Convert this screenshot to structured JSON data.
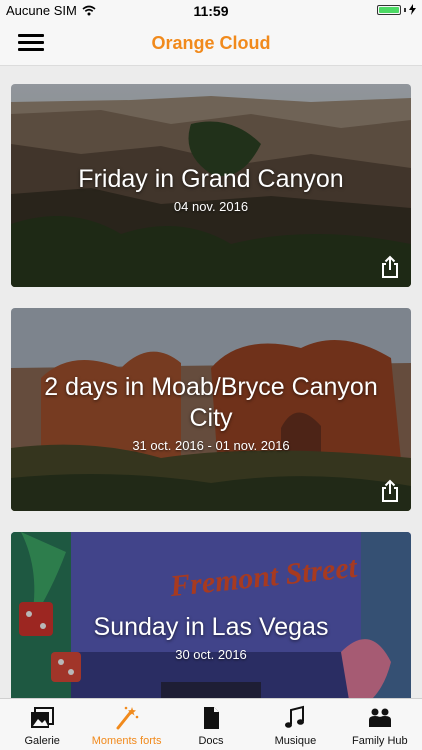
{
  "status_bar": {
    "carrier": "Aucune SIM",
    "time": "11:59",
    "battery_level": 1.0
  },
  "nav": {
    "title": "Orange Cloud",
    "accent_color": "#f18a1c"
  },
  "cards": [
    {
      "title": "Friday in Grand Canyon",
      "date": "04 nov. 2016"
    },
    {
      "title": "2 days in Moab/Bryce Canyon City",
      "date": "31 oct. 2016 - 01 nov. 2016"
    },
    {
      "title": "Sunday in Las Vegas",
      "date": "30 oct. 2016",
      "sign_text": "Fremont Street"
    }
  ],
  "tabs": [
    {
      "label": "Galerie",
      "icon": "photo-gallery-icon",
      "active": false
    },
    {
      "label": "Moments forts",
      "icon": "magic-wand-icon",
      "active": true
    },
    {
      "label": "Docs",
      "icon": "document-icon",
      "active": false
    },
    {
      "label": "Musique",
      "icon": "music-note-icon",
      "active": false
    },
    {
      "label": "Family Hub",
      "icon": "family-icon",
      "active": false
    }
  ]
}
